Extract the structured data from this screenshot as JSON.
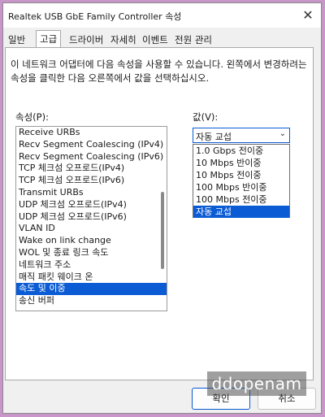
{
  "window": {
    "title": "Realtek USB GbE Family Controller 속성",
    "close_glyph": "✕"
  },
  "tabs": [
    {
      "label": "일반"
    },
    {
      "label": "고급"
    },
    {
      "label": "드라이버"
    },
    {
      "label": "자세히"
    },
    {
      "label": "이벤트"
    },
    {
      "label": "전원 관리"
    }
  ],
  "active_tab": "고급",
  "description": "이 네트워크 어댑터에 다음 속성을 사용할 수 있습니다. 왼쪽에서 변경하려는 속성을 클릭한 다음 오른쪽에서 값을 선택하십시오.",
  "property_label": "속성(P):",
  "value_label": "값(V):",
  "properties": [
    {
      "label": "Receive URBs"
    },
    {
      "label": "Recv Segment Coalescing (IPv4)"
    },
    {
      "label": "Recv Segment Coalescing (IPv6)"
    },
    {
      "label": "TCP 체크섬 오프로드(IPv4)"
    },
    {
      "label": "TCP 체크섬 오프로드(IPv6)"
    },
    {
      "label": "Transmit URBs"
    },
    {
      "label": "UDP 체크섬 오프로드(IPv4)"
    },
    {
      "label": "UDP 체크섬 오프로드(IPv6)"
    },
    {
      "label": "VLAN ID"
    },
    {
      "label": "Wake on link change"
    },
    {
      "label": "WOL 및 종료 링크 속도"
    },
    {
      "label": "네트워크 주소"
    },
    {
      "label": "매직 패킷 웨이크 온"
    },
    {
      "label": "속도 및 이중"
    },
    {
      "label": "송신 버퍼"
    }
  ],
  "selected_property": "속도 및 이중",
  "value_select": {
    "current": "자동 교섭",
    "chevron": "⌄"
  },
  "value_options": [
    {
      "label": "1.0 Gbps 전이중"
    },
    {
      "label": "10 Mbps 반이중"
    },
    {
      "label": "10 Mbps 전이중"
    },
    {
      "label": "100 Mbps 반이중"
    },
    {
      "label": "100 Mbps 전이중"
    },
    {
      "label": "자동 교섭"
    }
  ],
  "selected_option": "자동 교섭",
  "buttons": {
    "ok": "확인",
    "cancel": "취소"
  },
  "watermark": "ddopenam",
  "colors": {
    "selection": "#0a5bd4",
    "background": "#c896c8"
  }
}
